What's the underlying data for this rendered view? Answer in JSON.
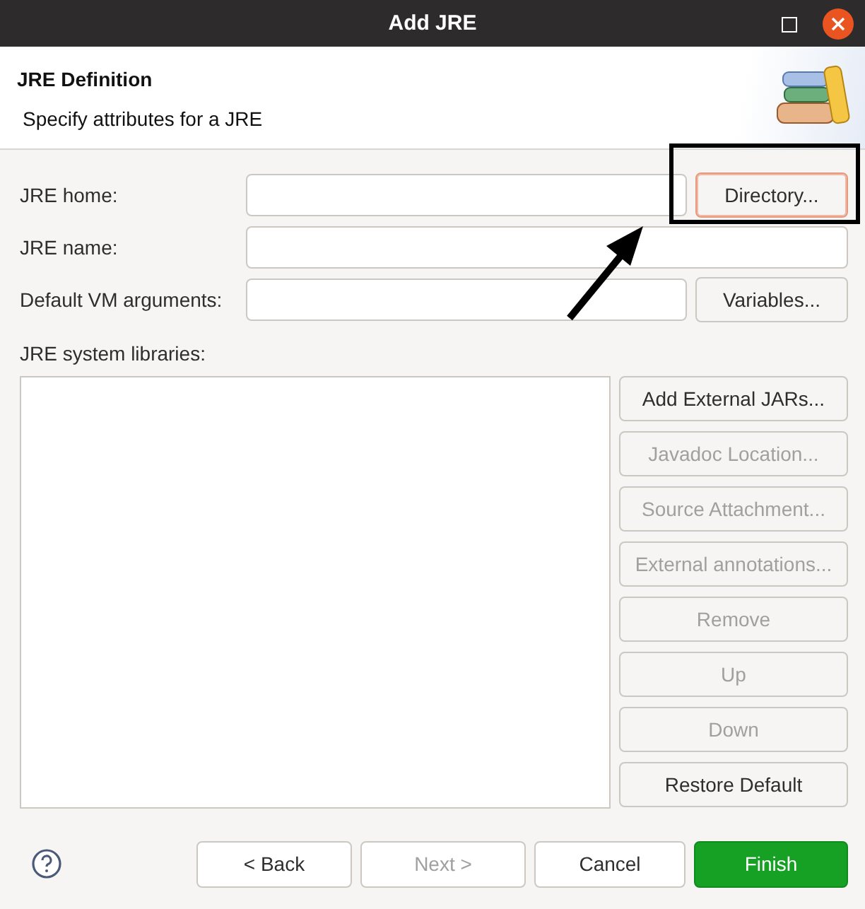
{
  "window": {
    "title": "Add JRE"
  },
  "header": {
    "title": "JRE Definition",
    "subtitle": "Specify attributes for a JRE"
  },
  "fields": [
    {
      "label": "JRE home:",
      "button": {
        "label": "Directory...",
        "focused": true
      }
    },
    {
      "label": "JRE name:"
    },
    {
      "label": "Default VM arguments:",
      "button": {
        "label": "Variables...",
        "focused": false
      }
    }
  ],
  "libraries": {
    "label": "JRE system libraries:",
    "buttons": [
      {
        "label": "Add External JARs...",
        "disabled": false
      },
      {
        "label": "Javadoc Location...",
        "disabled": true
      },
      {
        "label": "Source Attachment...",
        "disabled": true
      },
      {
        "label": "External annotations...",
        "disabled": true
      },
      {
        "label": "Remove",
        "disabled": true
      },
      {
        "label": "Up",
        "disabled": true
      },
      {
        "label": "Down",
        "disabled": true
      },
      {
        "label": "Restore Default",
        "disabled": false
      }
    ]
  },
  "footer": {
    "buttons": [
      {
        "label": "< Back",
        "disabled": false,
        "kind": "normal"
      },
      {
        "label": "Next >",
        "disabled": true,
        "kind": "normal"
      },
      {
        "label": "Cancel",
        "disabled": false,
        "kind": "normal"
      },
      {
        "label": "Finish",
        "disabled": false,
        "kind": "default"
      }
    ]
  }
}
